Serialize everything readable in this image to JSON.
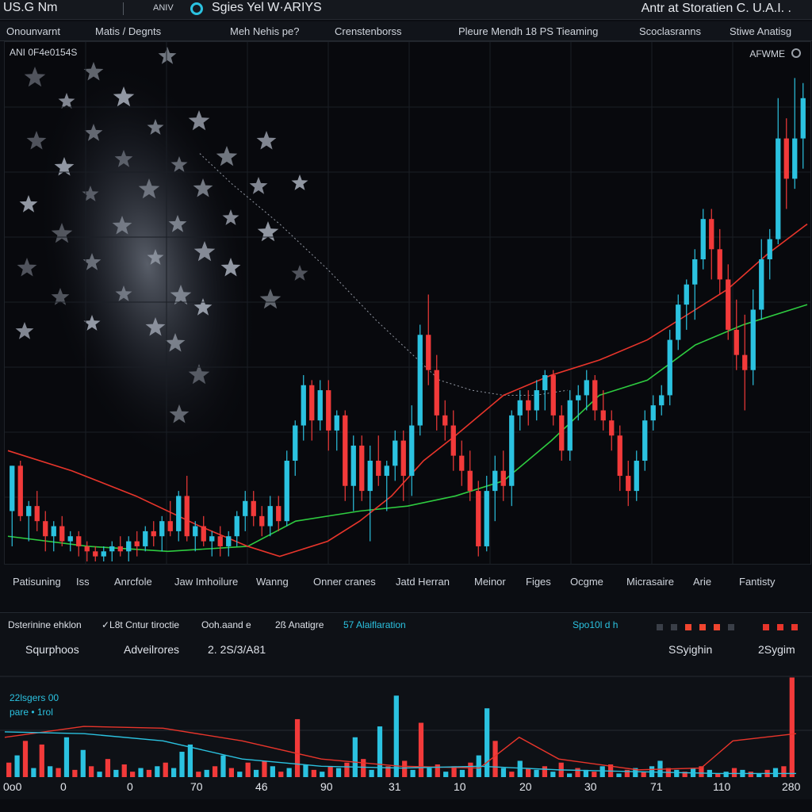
{
  "topbar": {
    "app_title": "US.G Nm",
    "symbol": "ANIV",
    "ticker_name": "Sgies Yel W·ARIYS",
    "right_title": "Antr at Storatien C. U.A.I. ."
  },
  "menu": [
    "Onounvarnt",
    "Matis / Degnts",
    "Meh Nehis pe?",
    "Crenstenborss",
    "Pleure Mendh  18 PS Tieaming",
    "Scoclasranns",
    "Stiwe Anatisg"
  ],
  "panel": {
    "id_label": "ANI 0F4e0154S",
    "mode_label": "AFWME"
  },
  "x_labels": [
    "Patisuning",
    "Iss",
    "Anrcfole",
    "Jaw Imhoilure",
    "Wanng",
    "Onner cranes",
    "Jatd Herran",
    "Meinor",
    "Figes",
    "Ocgme",
    "Micrasaire",
    "Arie",
    "Fantisty"
  ],
  "bottom": {
    "row1": [
      {
        "text": "Dsterinine ehklon",
        "color": "#dde1e8"
      },
      {
        "text": "✓L8t Cntur tiroctie",
        "color": "#dde1e8"
      },
      {
        "text": "Ooh.aand e",
        "color": "#dde1e8"
      },
      {
        "text": "2ß Anatigre",
        "color": "#dde1e8"
      },
      {
        "text": "57 Alaiflaration",
        "color": "#2bc2e0"
      },
      {
        "text": "Spo10l d h",
        "color": "#2bc2e0"
      }
    ],
    "row2": [
      {
        "text": "Squrphoos"
      },
      {
        "text": "Adveilrores"
      },
      {
        "text": "2. 2S/3/A81"
      },
      {
        "text": "SSyighin"
      },
      {
        "text": "2Sygim"
      }
    ],
    "legend_line1": "22lsgers   00",
    "legend_line2": "pare  • 1rol",
    "x_ticks": [
      "0o0",
      "0",
      "0",
      "70",
      "46",
      "90",
      "31",
      "10",
      "20",
      "30",
      "71",
      "110",
      "280"
    ]
  },
  "colors": {
    "up": "#2bc2e0",
    "down": "#f23a3a",
    "ma_slow": "#2ecc40",
    "ma_fast": "#e8352b",
    "dotted": "#b5bcc8"
  },
  "chart_data": {
    "type": "candlestick",
    "title": "",
    "xlabel": "",
    "ylabel": "",
    "grid": true,
    "ylim": [
      0,
      100
    ],
    "candles": [
      [
        10,
        19,
        3,
        19
      ],
      [
        19,
        20,
        8,
        9
      ],
      [
        9,
        12,
        4,
        11
      ],
      [
        11,
        14,
        6,
        8
      ],
      [
        8,
        10,
        2,
        5
      ],
      [
        5,
        8,
        2,
        7
      ],
      [
        7,
        9,
        3,
        4
      ],
      [
        4,
        6,
        2,
        5
      ],
      [
        5,
        6,
        1,
        3
      ],
      [
        3,
        4,
        0,
        2
      ],
      [
        2,
        3,
        0,
        1
      ],
      [
        1,
        3,
        0,
        2
      ],
      [
        2,
        4,
        0,
        3
      ],
      [
        3,
        5,
        1,
        2
      ],
      [
        2,
        5,
        0,
        4
      ],
      [
        4,
        6,
        1,
        3
      ],
      [
        3,
        7,
        2,
        6
      ],
      [
        6,
        8,
        3,
        5
      ],
      [
        5,
        9,
        2,
        8
      ],
      [
        8,
        12,
        5,
        6
      ],
      [
        6,
        14,
        4,
        13
      ],
      [
        13,
        17,
        4,
        5
      ],
      [
        5,
        8,
        2,
        7
      ],
      [
        7,
        9,
        3,
        4
      ],
      [
        4,
        6,
        1,
        5
      ],
      [
        5,
        7,
        1,
        3
      ],
      [
        3,
        6,
        1,
        5
      ],
      [
        5,
        10,
        3,
        9
      ],
      [
        9,
        14,
        6,
        12
      ],
      [
        12,
        14,
        7,
        9
      ],
      [
        9,
        11,
        5,
        7
      ],
      [
        7,
        13,
        5,
        11
      ],
      [
        11,
        13,
        6,
        8
      ],
      [
        8,
        22,
        7,
        20
      ],
      [
        20,
        28,
        17,
        27
      ],
      [
        27,
        37,
        24,
        35
      ],
      [
        35,
        36,
        24,
        28
      ],
      [
        28,
        36,
        26,
        34
      ],
      [
        34,
        36,
        22,
        26
      ],
      [
        26,
        30,
        22,
        29
      ],
      [
        29,
        30,
        12,
        15
      ],
      [
        15,
        25,
        10,
        23
      ],
      [
        23,
        25,
        12,
        14
      ],
      [
        14,
        23,
        4,
        20
      ],
      [
        20,
        25,
        15,
        17
      ],
      [
        17,
        20,
        10,
        19
      ],
      [
        19,
        26,
        16,
        24
      ],
      [
        24,
        26,
        12,
        17
      ],
      [
        17,
        31,
        13,
        27
      ],
      [
        27,
        47,
        25,
        45
      ],
      [
        45,
        53,
        35,
        38
      ],
      [
        38,
        41,
        26,
        29
      ],
      [
        29,
        32,
        24,
        27
      ],
      [
        27,
        30,
        18,
        21
      ],
      [
        21,
        24,
        15,
        18
      ],
      [
        18,
        22,
        12,
        14
      ],
      [
        14,
        16,
        1,
        3
      ],
      [
        3,
        17,
        2,
        14
      ],
      [
        14,
        21,
        8,
        18
      ],
      [
        18,
        22,
        12,
        15
      ],
      [
        15,
        30,
        11,
        29
      ],
      [
        29,
        34,
        26,
        32
      ],
      [
        32,
        34,
        27,
        30
      ],
      [
        30,
        36,
        28,
        34
      ],
      [
        34,
        38,
        30,
        37
      ],
      [
        37,
        38,
        27,
        29
      ],
      [
        29,
        31,
        20,
        22
      ],
      [
        22,
        34,
        20,
        32
      ],
      [
        32,
        35,
        28,
        33
      ],
      [
        33,
        38,
        30,
        36
      ],
      [
        36,
        37,
        28,
        30
      ],
      [
        30,
        34,
        26,
        28
      ],
      [
        28,
        30,
        22,
        25
      ],
      [
        25,
        27,
        14,
        17
      ],
      [
        17,
        20,
        11,
        14
      ],
      [
        14,
        22,
        12,
        20
      ],
      [
        20,
        30,
        18,
        28
      ],
      [
        28,
        33,
        26,
        31
      ],
      [
        31,
        35,
        29,
        33
      ],
      [
        33,
        46,
        31,
        44
      ],
      [
        44,
        53,
        42,
        51
      ],
      [
        51,
        56,
        46,
        55
      ],
      [
        55,
        62,
        48,
        60
      ],
      [
        60,
        70,
        58,
        68
      ],
      [
        68,
        70,
        56,
        62
      ],
      [
        62,
        66,
        53,
        56
      ],
      [
        56,
        59,
        44,
        46
      ],
      [
        46,
        52,
        38,
        41
      ],
      [
        41,
        49,
        30,
        38
      ],
      [
        38,
        54,
        35,
        50
      ],
      [
        50,
        64,
        48,
        60
      ],
      [
        60,
        66,
        56,
        64
      ],
      [
        64,
        92,
        63,
        84
      ],
      [
        84,
        88,
        70,
        76
      ],
      [
        76,
        96,
        74,
        84
      ],
      [
        84,
        95,
        78,
        92
      ]
    ],
    "ma_fast": [
      [
        0,
        22
      ],
      [
        8,
        18
      ],
      [
        16,
        13
      ],
      [
        24,
        7
      ],
      [
        30,
        3
      ],
      [
        34,
        1
      ],
      [
        40,
        4
      ],
      [
        44,
        8
      ],
      [
        48,
        13
      ],
      [
        52,
        20
      ],
      [
        56,
        25
      ],
      [
        62,
        33
      ],
      [
        68,
        37
      ],
      [
        74,
        40
      ],
      [
        80,
        44
      ],
      [
        86,
        50
      ],
      [
        90,
        54
      ],
      [
        95,
        61
      ],
      [
        100,
        67
      ]
    ],
    "ma_slow": [
      [
        0,
        5
      ],
      [
        10,
        3
      ],
      [
        20,
        2
      ],
      [
        30,
        3
      ],
      [
        36,
        8
      ],
      [
        44,
        10
      ],
      [
        50,
        11
      ],
      [
        56,
        13
      ],
      [
        62,
        16
      ],
      [
        68,
        24
      ],
      [
        74,
        33
      ],
      [
        80,
        36
      ],
      [
        86,
        43
      ],
      [
        92,
        47
      ],
      [
        100,
        51
      ]
    ],
    "dotted_trend": [
      [
        24,
        81
      ],
      [
        28,
        75
      ],
      [
        34,
        67
      ],
      [
        40,
        58
      ],
      [
        46,
        48
      ],
      [
        50,
        42
      ],
      [
        54,
        36
      ],
      [
        58,
        34
      ],
      [
        62,
        33
      ],
      [
        66,
        33
      ],
      [
        70,
        34
      ]
    ],
    "volume": {
      "bars": [
        [
          8,
          0
        ],
        [
          12,
          1
        ],
        [
          20,
          0
        ],
        [
          5,
          1
        ],
        [
          18,
          0
        ],
        [
          6,
          1
        ],
        [
          5,
          0
        ],
        [
          22,
          1
        ],
        [
          4,
          0
        ],
        [
          15,
          1
        ],
        [
          6,
          0
        ],
        [
          3,
          1
        ],
        [
          10,
          0
        ],
        [
          4,
          1
        ],
        [
          7,
          0
        ],
        [
          3,
          0
        ],
        [
          5,
          1
        ],
        [
          4,
          0
        ],
        [
          6,
          1
        ],
        [
          8,
          0
        ],
        [
          5,
          1
        ],
        [
          14,
          1
        ],
        [
          18,
          1
        ],
        [
          3,
          0
        ],
        [
          4,
          1
        ],
        [
          6,
          0
        ],
        [
          12,
          1
        ],
        [
          5,
          0
        ],
        [
          3,
          1
        ],
        [
          8,
          0
        ],
        [
          4,
          1
        ],
        [
          9,
          0
        ],
        [
          6,
          1
        ],
        [
          3,
          0
        ],
        [
          5,
          1
        ],
        [
          32,
          0
        ],
        [
          7,
          1
        ],
        [
          4,
          0
        ],
        [
          3,
          1
        ],
        [
          6,
          0
        ],
        [
          5,
          1
        ],
        [
          8,
          0
        ],
        [
          22,
          1
        ],
        [
          10,
          0
        ],
        [
          4,
          1
        ],
        [
          28,
          1
        ],
        [
          6,
          0
        ],
        [
          45,
          1
        ],
        [
          9,
          0
        ],
        [
          4,
          1
        ],
        [
          30,
          0
        ],
        [
          5,
          1
        ],
        [
          7,
          0
        ],
        [
          3,
          1
        ],
        [
          6,
          0
        ],
        [
          4,
          1
        ],
        [
          8,
          0
        ],
        [
          12,
          1
        ],
        [
          38,
          1
        ],
        [
          20,
          0
        ],
        [
          5,
          1
        ],
        [
          3,
          0
        ],
        [
          9,
          1
        ],
        [
          5,
          0
        ],
        [
          4,
          1
        ],
        [
          6,
          0
        ],
        [
          3,
          1
        ],
        [
          8,
          0
        ],
        [
          2,
          1
        ],
        [
          5,
          0
        ],
        [
          4,
          1
        ],
        [
          3,
          0
        ],
        [
          6,
          1
        ],
        [
          7,
          0
        ],
        [
          2,
          1
        ],
        [
          4,
          0
        ],
        [
          5,
          1
        ],
        [
          3,
          0
        ],
        [
          6,
          1
        ],
        [
          9,
          1
        ],
        [
          5,
          0
        ],
        [
          4,
          1
        ],
        [
          3,
          0
        ],
        [
          5,
          1
        ],
        [
          6,
          0
        ],
        [
          4,
          1
        ],
        [
          2,
          0
        ],
        [
          3,
          1
        ],
        [
          5,
          0
        ],
        [
          4,
          1
        ],
        [
          3,
          0
        ],
        [
          2,
          1
        ],
        [
          4,
          0
        ],
        [
          5,
          1
        ],
        [
          6,
          0
        ],
        [
          55,
          0
        ]
      ],
      "overlay_red": [
        [
          0,
          22
        ],
        [
          10,
          28
        ],
        [
          20,
          27
        ],
        [
          30,
          20
        ],
        [
          40,
          10
        ],
        [
          50,
          6
        ],
        [
          60,
          5
        ],
        [
          65,
          22
        ],
        [
          70,
          10
        ],
        [
          80,
          4
        ],
        [
          88,
          5
        ],
        [
          92,
          20
        ],
        [
          100,
          24
        ]
      ],
      "overlay_teal": [
        [
          0,
          25
        ],
        [
          10,
          24
        ],
        [
          20,
          20
        ],
        [
          30,
          10
        ],
        [
          40,
          6
        ],
        [
          50,
          5
        ],
        [
          60,
          6
        ],
        [
          70,
          4
        ],
        [
          80,
          3
        ],
        [
          90,
          2
        ],
        [
          100,
          2
        ]
      ]
    }
  }
}
